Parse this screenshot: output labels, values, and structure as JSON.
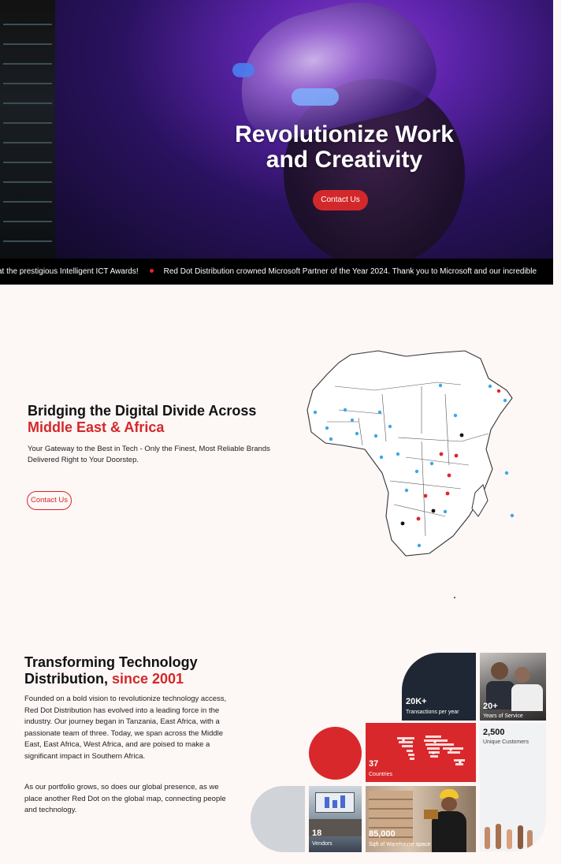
{
  "hero": {
    "title_line1": "Revolutionize Work",
    "title_line2": "and Creativity",
    "cta": "Contact Us"
  },
  "ticker": {
    "item1": "at the prestigious Intelligent ICT Awards!",
    "item2": "Red Dot Distribution crowned Microsoft Partner of the Year 2024. Thank you to Microsoft and our incredible"
  },
  "bridge": {
    "title_line1": "Bridging the Digital Divide Across",
    "title_line2": "Middle East & Africa",
    "subtitle_line1": "Your Gateway to the Best in Tech - Only the Finest, Most Reliable Brands",
    "subtitle_line2": "Delivered Right to Your Doorstep.",
    "cta": "Contact Us"
  },
  "about": {
    "title_line1": "Transforming Technology",
    "title_line2_a": "Distribution, ",
    "title_line2_b": "since 2001",
    "para1": "Founded on a bold vision to revolutionize technology access, Red Dot Distribution has evolved into a leading force in the industry. Our journey began in Tanzania, East Africa, with a passionate team of three. Today, we span across the Middle East, East Africa, West Africa, and are poised to make a significant impact in Southern Africa.",
    "para2": "As our portfolio grows, so does our global presence, as we place another Red Dot on the global map, connecting people and technology."
  },
  "stats": {
    "transactions": {
      "value": "20K+",
      "label": "Transactions per year"
    },
    "years": {
      "value": "20+",
      "label": "Years of Service"
    },
    "customers": {
      "value": "2,500",
      "label": "Unique Customers"
    },
    "countries": {
      "value": "37",
      "label": "Countries"
    },
    "vendors": {
      "value": "18",
      "label": "Vendors"
    },
    "warehouse": {
      "value": "85,000",
      "label": "Sqft of Warehouse space"
    }
  },
  "colors": {
    "brand_red": "#d3282a",
    "navy": "#1f2734",
    "ticker_bg": "#000000",
    "page_bg": "#fdf7f6"
  }
}
